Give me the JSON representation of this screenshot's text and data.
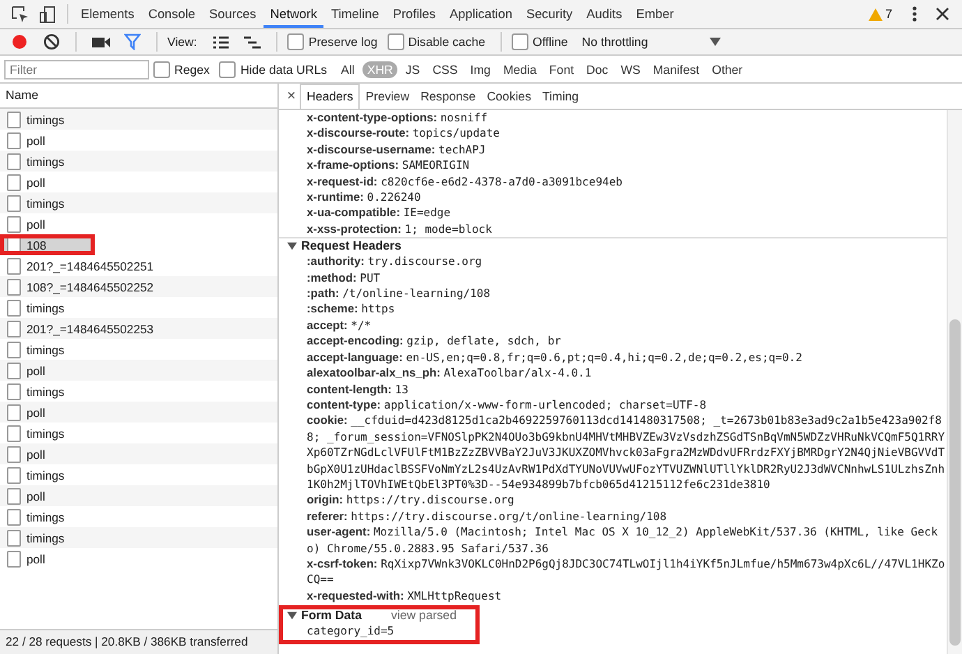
{
  "top_tabs": [
    {
      "label": "Elements",
      "selected": false
    },
    {
      "label": "Console",
      "selected": false
    },
    {
      "label": "Sources",
      "selected": false
    },
    {
      "label": "Network",
      "selected": true
    },
    {
      "label": "Timeline",
      "selected": false
    },
    {
      "label": "Profiles",
      "selected": false
    },
    {
      "label": "Application",
      "selected": false
    },
    {
      "label": "Security",
      "selected": false
    },
    {
      "label": "Audits",
      "selected": false
    },
    {
      "label": "Ember",
      "selected": false
    }
  ],
  "warning_count": "7",
  "toolbar": {
    "recording": true,
    "filter_on": true,
    "view_label": "View:",
    "options": [
      {
        "label": "Preserve log",
        "checked": false
      },
      {
        "label": "Disable cache",
        "checked": false
      },
      {
        "label": "Offline",
        "checked": false
      }
    ],
    "throttling": "No throttling"
  },
  "filter_bar": {
    "placeholder": "Filter",
    "options": [
      {
        "label": "Regex",
        "checked": false
      },
      {
        "label": "Hide data URLs",
        "checked": false
      }
    ],
    "types": [
      {
        "label": "All",
        "selected": false
      },
      {
        "label": "XHR",
        "selected": true
      },
      {
        "label": "JS",
        "selected": false
      },
      {
        "label": "CSS",
        "selected": false
      },
      {
        "label": "Img",
        "selected": false
      },
      {
        "label": "Media",
        "selected": false
      },
      {
        "label": "Font",
        "selected": false
      },
      {
        "label": "Doc",
        "selected": false
      },
      {
        "label": "WS",
        "selected": false
      },
      {
        "label": "Manifest",
        "selected": false
      },
      {
        "label": "Other",
        "selected": false
      }
    ]
  },
  "requests": {
    "column": "Name",
    "rows": [
      {
        "name": "timings",
        "selected": false,
        "highlighted": false
      },
      {
        "name": "poll",
        "selected": false,
        "highlighted": false
      },
      {
        "name": "timings",
        "selected": false,
        "highlighted": false
      },
      {
        "name": "poll",
        "selected": false,
        "highlighted": false
      },
      {
        "name": "timings",
        "selected": false,
        "highlighted": false
      },
      {
        "name": "poll",
        "selected": false,
        "highlighted": false
      },
      {
        "name": "108",
        "selected": true,
        "highlighted": true
      },
      {
        "name": "201?_=1484645502251",
        "selected": false,
        "highlighted": false
      },
      {
        "name": "108?_=1484645502252",
        "selected": false,
        "highlighted": false
      },
      {
        "name": "timings",
        "selected": false,
        "highlighted": false
      },
      {
        "name": "201?_=1484645502253",
        "selected": false,
        "highlighted": false
      },
      {
        "name": "timings",
        "selected": false,
        "highlighted": false
      },
      {
        "name": "poll",
        "selected": false,
        "highlighted": false
      },
      {
        "name": "timings",
        "selected": false,
        "highlighted": false
      },
      {
        "name": "poll",
        "selected": false,
        "highlighted": false
      },
      {
        "name": "timings",
        "selected": false,
        "highlighted": false
      },
      {
        "name": "poll",
        "selected": false,
        "highlighted": false
      },
      {
        "name": "timings",
        "selected": false,
        "highlighted": false
      },
      {
        "name": "poll",
        "selected": false,
        "highlighted": false
      },
      {
        "name": "timings",
        "selected": false,
        "highlighted": false
      },
      {
        "name": "timings",
        "selected": false,
        "highlighted": false
      },
      {
        "name": "poll",
        "selected": false,
        "highlighted": false
      }
    ],
    "status": "22 / 28 requests | 20.8KB / 386KB transferred"
  },
  "detail": {
    "close": "×",
    "tabs": [
      {
        "label": "Headers",
        "selected": true
      },
      {
        "label": "Preview",
        "selected": false
      },
      {
        "label": "Response",
        "selected": false
      },
      {
        "label": "Cookies",
        "selected": false
      },
      {
        "label": "Timing",
        "selected": false
      }
    ],
    "response_headers": [
      {
        "key": "x-content-type-options:",
        "value": "nosniff"
      },
      {
        "key": "x-discourse-route:",
        "value": "topics/update"
      },
      {
        "key": "x-discourse-username:",
        "value": "techAPJ"
      },
      {
        "key": "x-frame-options:",
        "value": "SAMEORIGIN"
      },
      {
        "key": "x-request-id:",
        "value": "c820cf6e-e6d2-4378-a7d0-a3091bce94eb"
      },
      {
        "key": "x-runtime:",
        "value": "0.226240"
      },
      {
        "key": "x-ua-compatible:",
        "value": "IE=edge"
      },
      {
        "key": "x-xss-protection:",
        "value": "1; mode=block"
      }
    ],
    "request_section": {
      "title": "Request Headers",
      "expanded": true
    },
    "request_headers": [
      {
        "key": ":authority:",
        "value": "try.discourse.org"
      },
      {
        "key": ":method:",
        "value": "PUT"
      },
      {
        "key": ":path:",
        "value": "/t/online-learning/108"
      },
      {
        "key": ":scheme:",
        "value": "https"
      },
      {
        "key": "accept:",
        "value": "*/*"
      },
      {
        "key": "accept-encoding:",
        "value": "gzip, deflate, sdch, br"
      },
      {
        "key": "accept-language:",
        "value": "en-US,en;q=0.8,fr;q=0.6,pt;q=0.4,hi;q=0.2,de;q=0.2,es;q=0.2"
      },
      {
        "key": "alexatoolbar-alx_ns_ph:",
        "value": "AlexaToolbar/alx-4.0.1"
      },
      {
        "key": "content-length:",
        "value": "13"
      },
      {
        "key": "content-type:",
        "value": "application/x-www-form-urlencoded; charset=UTF-8"
      },
      {
        "key": "cookie:",
        "value": "__cfduid=d423d8125d1ca2b4692259760113dcd141480317508; _t=2673b01b83e3ad9c2a1b5e423a902f88; _forum_session=VFNOSlpPK2N4OUo3bG9kbnU4MHVtMHBVZEw3VzVsdzhZSGdTSnBqVmN5WDZzVHRuNkVCQmF5Q1RRYXp60TZrNGdLclVFUlFtM1BzZzZBVVBaY2JuV3JKUXZOMVhvck03aFgra2MzWDdvUFRrdzFXYjBMRDgrY2N4QjNieVBGVVdTbGpX0U1zUHdaclBSSFVoNmYzL2s4UzAvRW1PdXdTYUNoVUVwUFozYTVUZWNlUTllYklDR2RyU2J3dWVCNnhwLS1ULzhsZnh1K0h2MjlTOVhIWEtQbEl3PT0%3D--54e934899b7bfcb065d41215112fe6c231de3810"
      },
      {
        "key": "origin:",
        "value": "https://try.discourse.org"
      },
      {
        "key": "referer:",
        "value": "https://try.discourse.org/t/online-learning/108"
      },
      {
        "key": "user-agent:",
        "value": "Mozilla/5.0 (Macintosh; Intel Mac OS X 10_12_2) AppleWebKit/537.36 (KHTML, like Gecko) Chrome/55.0.2883.95 Safari/537.36"
      },
      {
        "key": "x-csrf-token:",
        "value": "RqXixp7VWnk3VOKLC0HnD2P6gQj8JDC3OC74TLwOIjl1h4iYKf5nJLmfue/h5Mm673w4pXc6L//47VL1HKZoCQ=="
      },
      {
        "key": "x-requested-with:",
        "value": "XMLHttpRequest"
      }
    ],
    "form_data": {
      "title": "Form Data",
      "expanded": true,
      "highlighted": true,
      "link": "view parsed",
      "entries": [
        "category_id=5"
      ]
    }
  }
}
